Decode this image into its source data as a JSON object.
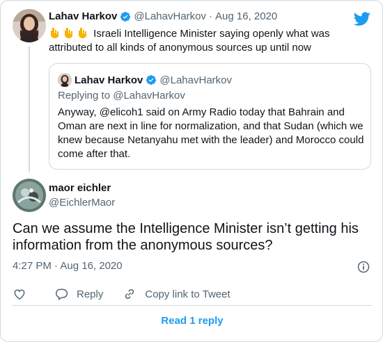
{
  "parent_tweet": {
    "author_name": "Lahav Harkov",
    "author_handle": "@LahavHarkov",
    "separator": "·",
    "date": "Aug 16, 2020",
    "text": "Israeli Intelligence Minister saying openly what was attributed to all kinds of anonymous sources up until now",
    "emojis": [
      "point-down-emoji",
      "point-down-emoji",
      "point-down-emoji"
    ]
  },
  "quoted_tweet": {
    "author_name": "Lahav Harkov",
    "author_handle": "@LahavHarkov",
    "replying_to": "Replying to @LahavHarkov",
    "text": "Anyway, @elicoh1 said on Army Radio today that Bahrain and Oman are next in line for normalization, and that Sudan (which we knew because Netanyahu met with the leader) and Morocco could come after that."
  },
  "main_tweet": {
    "author_name": "maor eichler",
    "author_handle": "@EichlerMaor",
    "text": "Can we assume the Intelligence Minister isn’t getting his information from the anonymous sources?",
    "time": "4:27 PM · Aug 16, 2020"
  },
  "actions": {
    "reply_label": "Reply",
    "copy_label": "Copy link to Tweet"
  },
  "read_reply_label": "Read 1 reply",
  "colors": {
    "accent": "#1d9bf0",
    "secondary_text": "#536471",
    "border": "#cfd9de"
  }
}
